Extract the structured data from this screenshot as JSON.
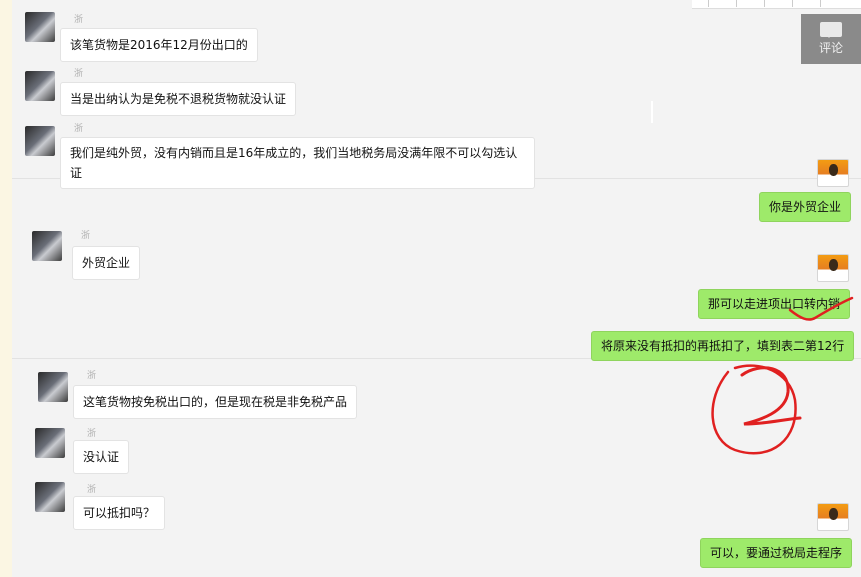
{
  "comment_button": {
    "label": "评论",
    "icon": "comment-icon"
  },
  "messages_left": [
    {
      "nick": "浙",
      "text": "该笔货物是2016年12月份出口的"
    },
    {
      "nick": "浙",
      "text": "当是出纳认为是免税不退税货物就没认证"
    },
    {
      "nick": "浙",
      "text": "我们是纯外贸，没有内销而且是16年成立的，我们当地税务局没满年限不可以勾选认证"
    },
    {
      "nick": "浙",
      "text": "外贸企业"
    },
    {
      "nick": "浙",
      "text": "这笔货物按免税出口的，但是现在税是非免税产品"
    },
    {
      "nick": "浙",
      "text": "没认证"
    },
    {
      "nick": "浙",
      "text": "可以抵扣吗？"
    }
  ],
  "messages_right": [
    {
      "text": "你是外贸企业"
    },
    {
      "text": "那可以走进项出口转内销"
    },
    {
      "text": "将原来没有抵扣的再抵扣了，填到表二第12行"
    },
    {
      "text": "可以，要通过税局走程序"
    }
  ],
  "annotation": {
    "handwritten_number": "2",
    "color": "#e02020"
  }
}
